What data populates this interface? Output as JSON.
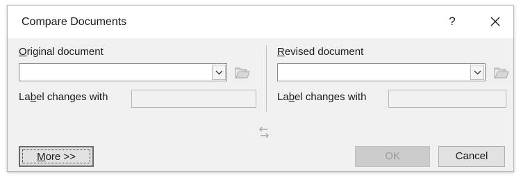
{
  "dialog": {
    "title": "Compare Documents",
    "help_glyph": "?",
    "close_glyph": "✕"
  },
  "original": {
    "heading": "Original document",
    "heading_access_key": "O",
    "heading_rest": "riginal document",
    "combo_value": "",
    "label_changes": "Label changes with",
    "label_pre": "La",
    "label_key": "b",
    "label_post": "el changes with",
    "label_value": ""
  },
  "revised": {
    "heading": "Revised document",
    "heading_access_key": "R",
    "heading_rest": "evised document",
    "combo_value": "",
    "label_changes": "Label changes with",
    "label_pre": "La",
    "label_key": "b",
    "label_post": "el changes with",
    "label_value": ""
  },
  "buttons": {
    "more_key": "M",
    "more_rest": "ore >>",
    "ok": "OK",
    "cancel": "Cancel"
  }
}
